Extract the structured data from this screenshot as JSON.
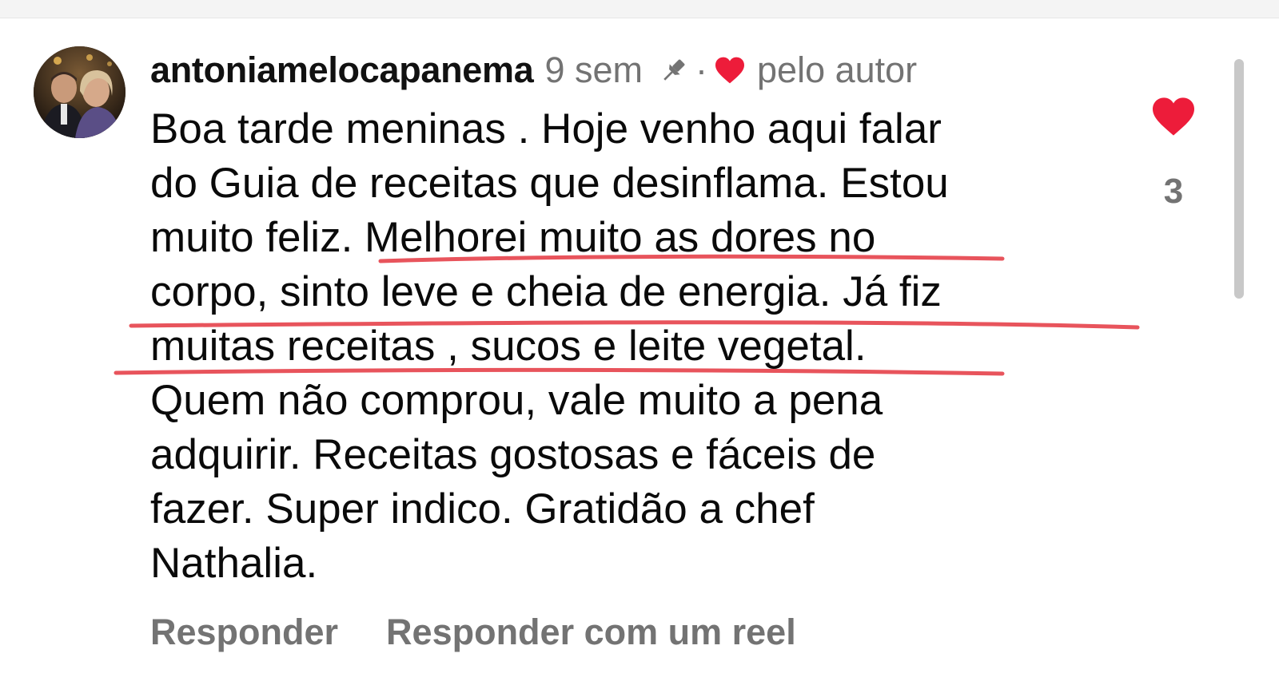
{
  "comment": {
    "author": "antoniamelocapanema",
    "time_ago": "9 sem",
    "liked_by_author_label": "pelo autor",
    "text": "Boa tarde meninas . Hoje venho aqui falar\ndo Guia de receitas que desinflama. Estou\nmuito feliz. Melhorei muito as dores no\ncorpo, sinto leve e cheia de energia. Já fiz\nmuitas receitas , sucos e leite vegetal.\nQuem não comprou, vale muito a pena\nadquirir. Receitas gostosas e fáceis de\nfazer. Super indico. Gratidão a chef\nNathalia.",
    "like_count": "3"
  },
  "actions": {
    "reply": "Responder",
    "reply_reel": "Responder com um reel"
  },
  "icons": {
    "pin": "pin-icon",
    "heart_small": "heart-icon",
    "like": "like-heart-icon"
  },
  "colors": {
    "heart": "#ed1c3a",
    "annotation": "#e8545c",
    "secondary_text": "#737373"
  }
}
